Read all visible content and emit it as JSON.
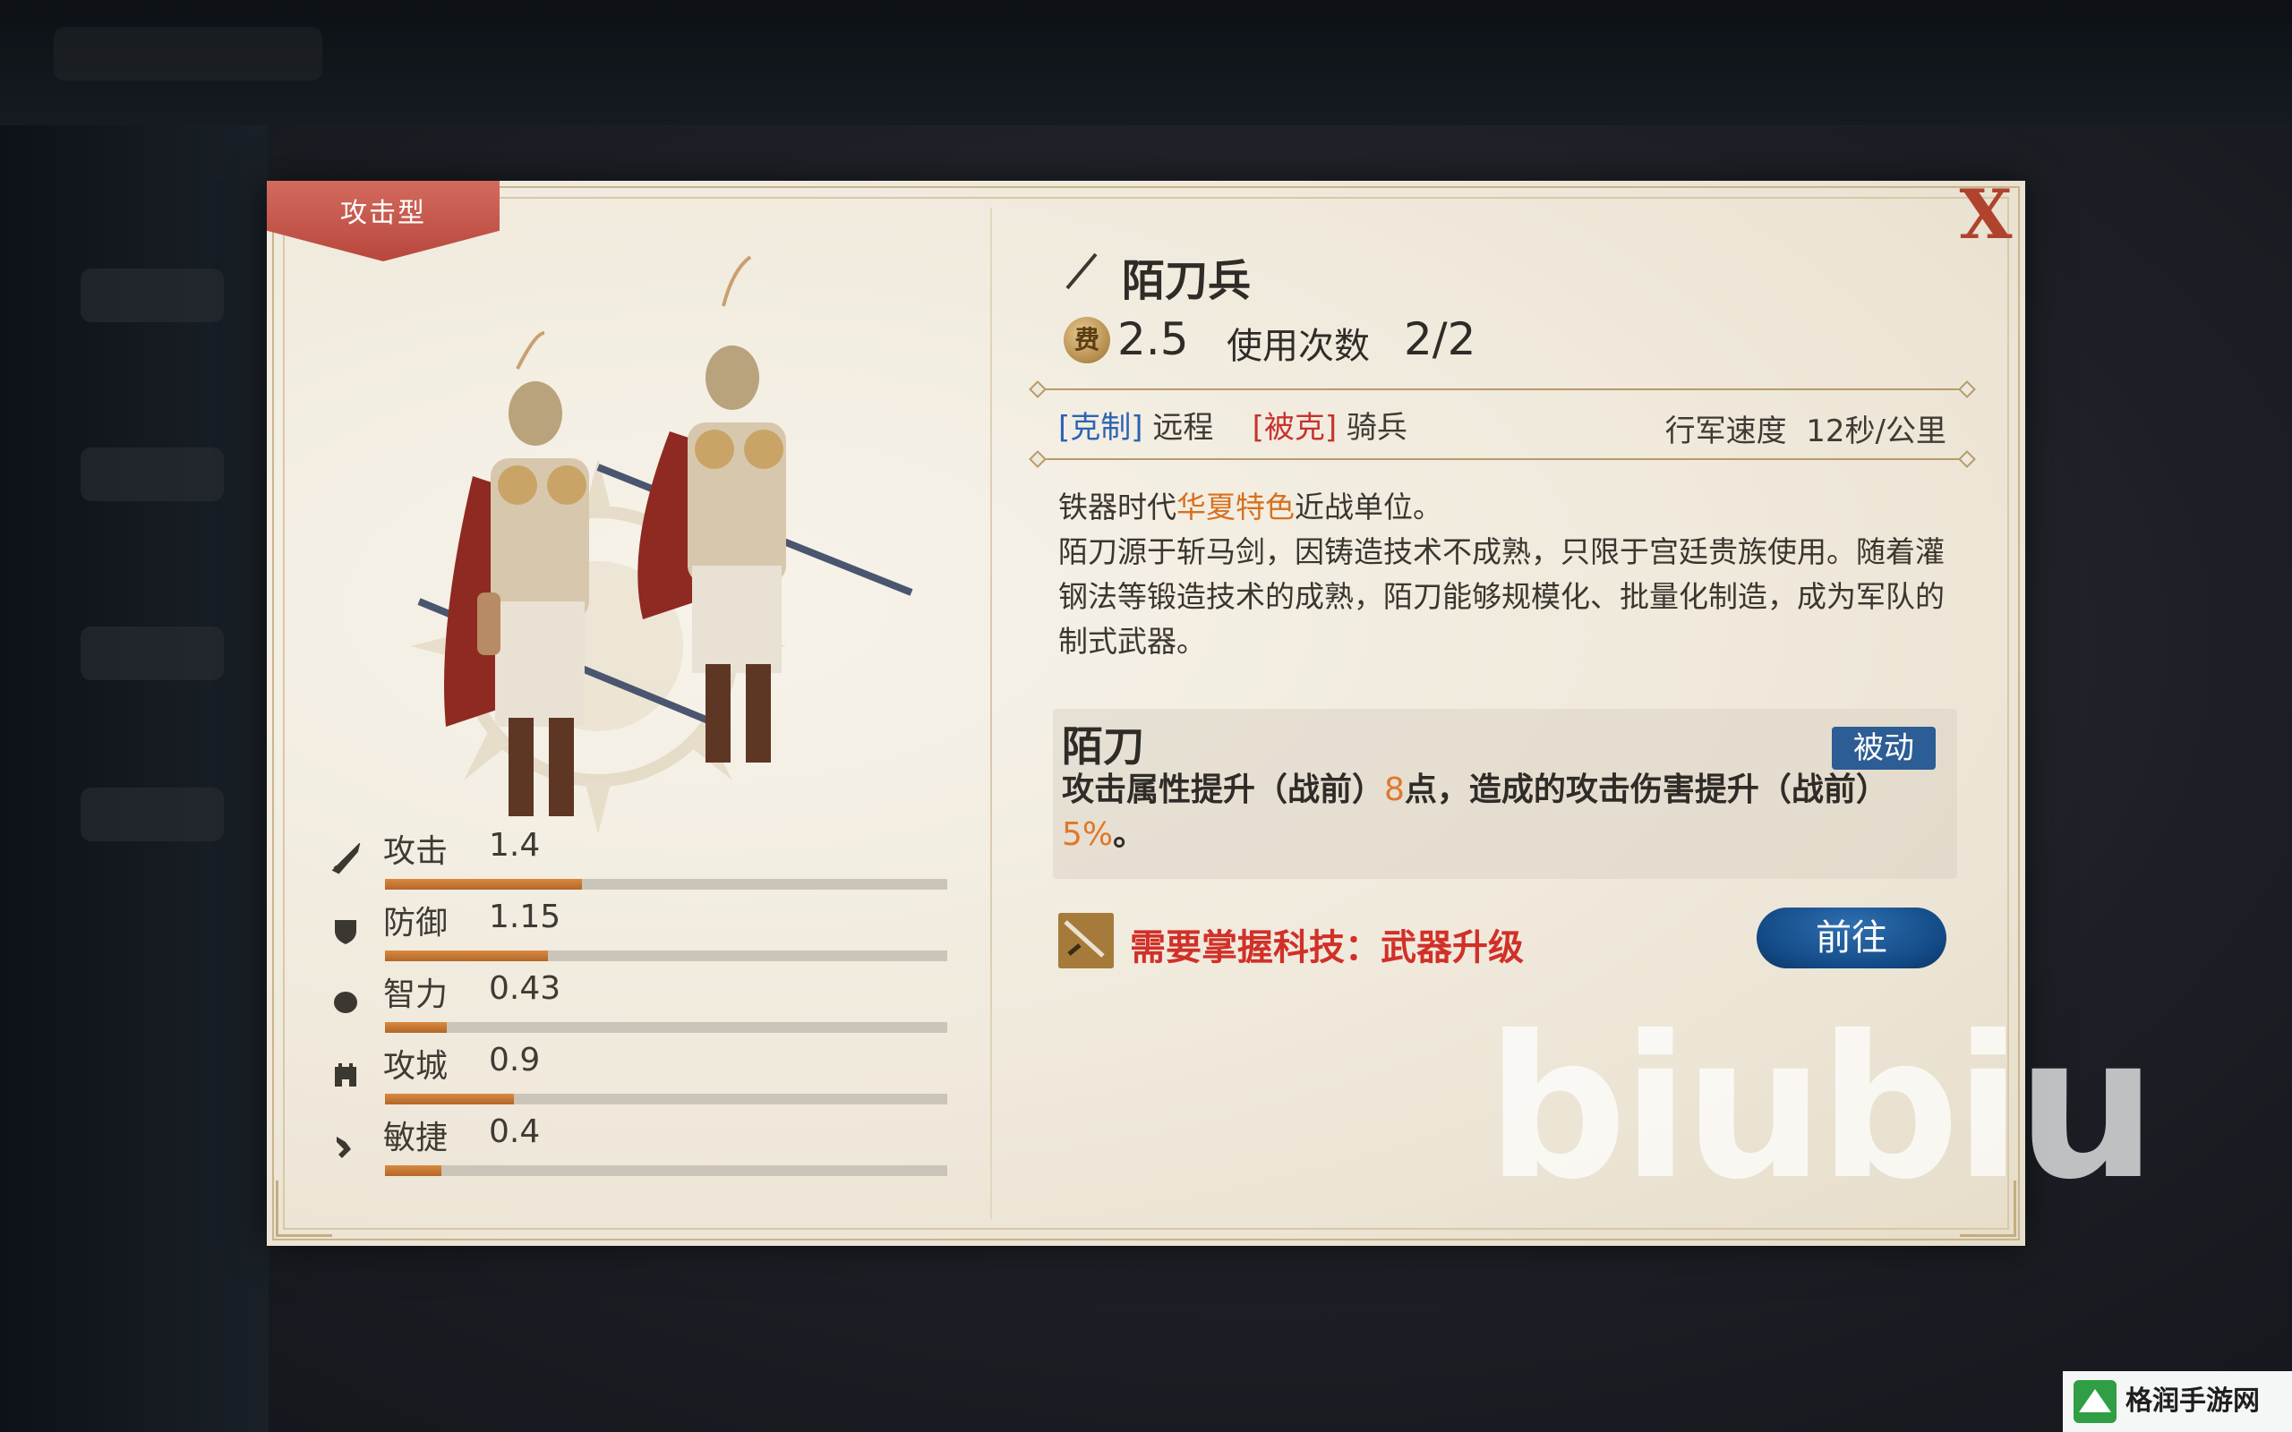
{
  "dialog": {
    "type_tag": "攻击型",
    "close_label": "X"
  },
  "unit": {
    "name": "陌刀兵",
    "cost": "2.5",
    "uses_label": "使用次数",
    "uses_value": "2/2",
    "cost_icon_char": "费"
  },
  "counters": {
    "counter_tag": "[克制]",
    "counter_target": "远程",
    "countered_tag": "[被克]",
    "countered_target": "骑兵",
    "march_label": "行军速度",
    "march_value": "12秒/公里"
  },
  "description": {
    "line1_prefix": "铁器时代",
    "line1_highlight": "华夏特色",
    "line1_suffix": "近战单位。",
    "body": "陌刀源于斩马剑，因铸造技术不成熟，只限于宫廷贵族使用。随着灌钢法等锻造技术的成熟，陌刀能够规模化、批量化制造，成为军队的制式武器。"
  },
  "skill": {
    "name": "陌刀",
    "badge": "被动",
    "desc_part1": "攻击属性提升（战前）",
    "desc_value1": "8",
    "desc_part2": "点，造成的攻击伤害提升（战前）",
    "desc_value2": "5%",
    "desc_part3": "。"
  },
  "tech": {
    "text": "需要掌握科技：武器升级",
    "go_button": "前往"
  },
  "stats": [
    {
      "label": "攻击",
      "value": "1.4",
      "fill": 0.35,
      "icon": "sword-icon"
    },
    {
      "label": "防御",
      "value": "1.15",
      "fill": 0.29,
      "icon": "shield-icon"
    },
    {
      "label": "智力",
      "value": "0.43",
      "fill": 0.11,
      "icon": "brain-icon"
    },
    {
      "label": "攻城",
      "value": "0.9",
      "fill": 0.23,
      "icon": "castle-icon"
    },
    {
      "label": "敏捷",
      "value": "0.4",
      "fill": 0.1,
      "icon": "boot-icon"
    }
  ],
  "watermark": "biubiu",
  "site_logo": "格润手游网",
  "colors": {
    "accent_red": "#b8473d",
    "button_blue": "#124a86",
    "highlight_orange": "#d7711f",
    "stat_fill": "#c27432"
  }
}
